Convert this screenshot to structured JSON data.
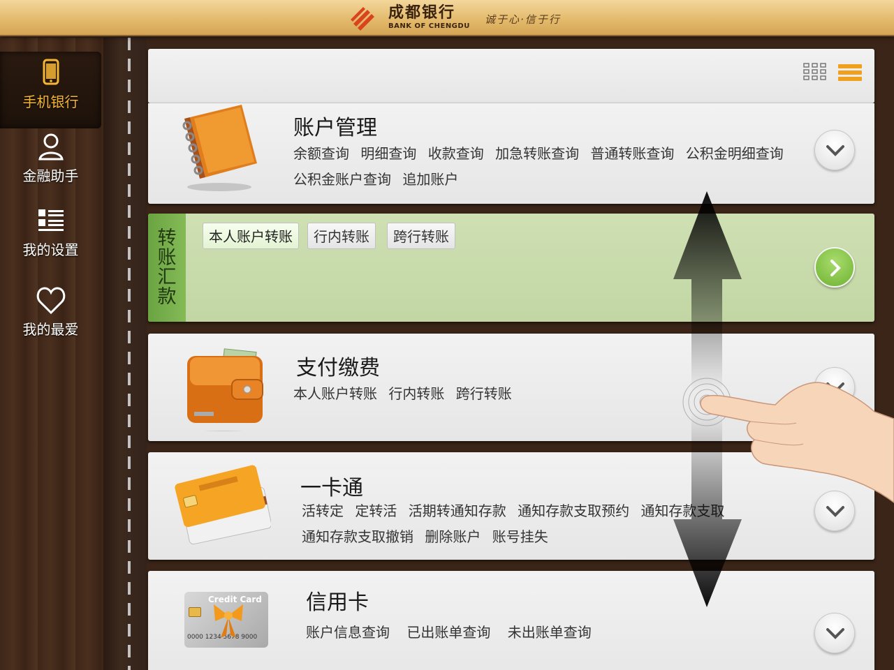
{
  "header": {
    "brand_cn": "成都银行",
    "brand_en": "BANK OF CHENGDU",
    "slogan": "诚于心·信于行"
  },
  "sidebar": {
    "items": [
      {
        "label": "手机银行",
        "icon": "phone-icon",
        "active": true
      },
      {
        "label": "金融助手",
        "icon": "person-icon",
        "active": false
      },
      {
        "label": "我的设置",
        "icon": "settings-list-icon",
        "active": false
      },
      {
        "label": "我的最爱",
        "icon": "heart-icon",
        "active": false
      }
    ]
  },
  "toolbar": {
    "icons": [
      "grid-view-icon",
      "list-view-icon"
    ]
  },
  "cards": {
    "account": {
      "title": "账户管理",
      "links": [
        "余额查询",
        "明细查询",
        "收款查询",
        "加急转账查询",
        "普通转账查询",
        "公积金明细查询",
        "公积金账户查询",
        "追加账户"
      ],
      "icon": "notebook-icon"
    },
    "transfer": {
      "tab_label": "转账汇款",
      "links": [
        "本人账户转账",
        "行内转账",
        "跨行转账"
      ],
      "selected": "本人账户转账"
    },
    "payment": {
      "title": "支付缴费",
      "links": [
        "本人账户转账",
        "行内转账",
        "跨行转账"
      ],
      "icon": "wallet-icon"
    },
    "one_card": {
      "title": "一卡通",
      "links": [
        "活转定",
        "定转活",
        "活期转通知存款",
        "通知存款支取预约",
        "通知存款支取",
        "通知存款支取撤销",
        "删除账户",
        "账号挂失"
      ],
      "icon": "bank-card-icon"
    },
    "credit": {
      "title": "信用卡",
      "links": [
        "账户信息查询",
        "已出账单查询",
        "未出账单查询"
      ],
      "icon": "credit-card-icon",
      "card_text": "Credit Card",
      "card_number": "0000 1234 5678 9000"
    }
  },
  "colors": {
    "accent_gold": "#f5b634",
    "green_panel": "#c8dcaa",
    "green_tab": "#78b04c"
  }
}
